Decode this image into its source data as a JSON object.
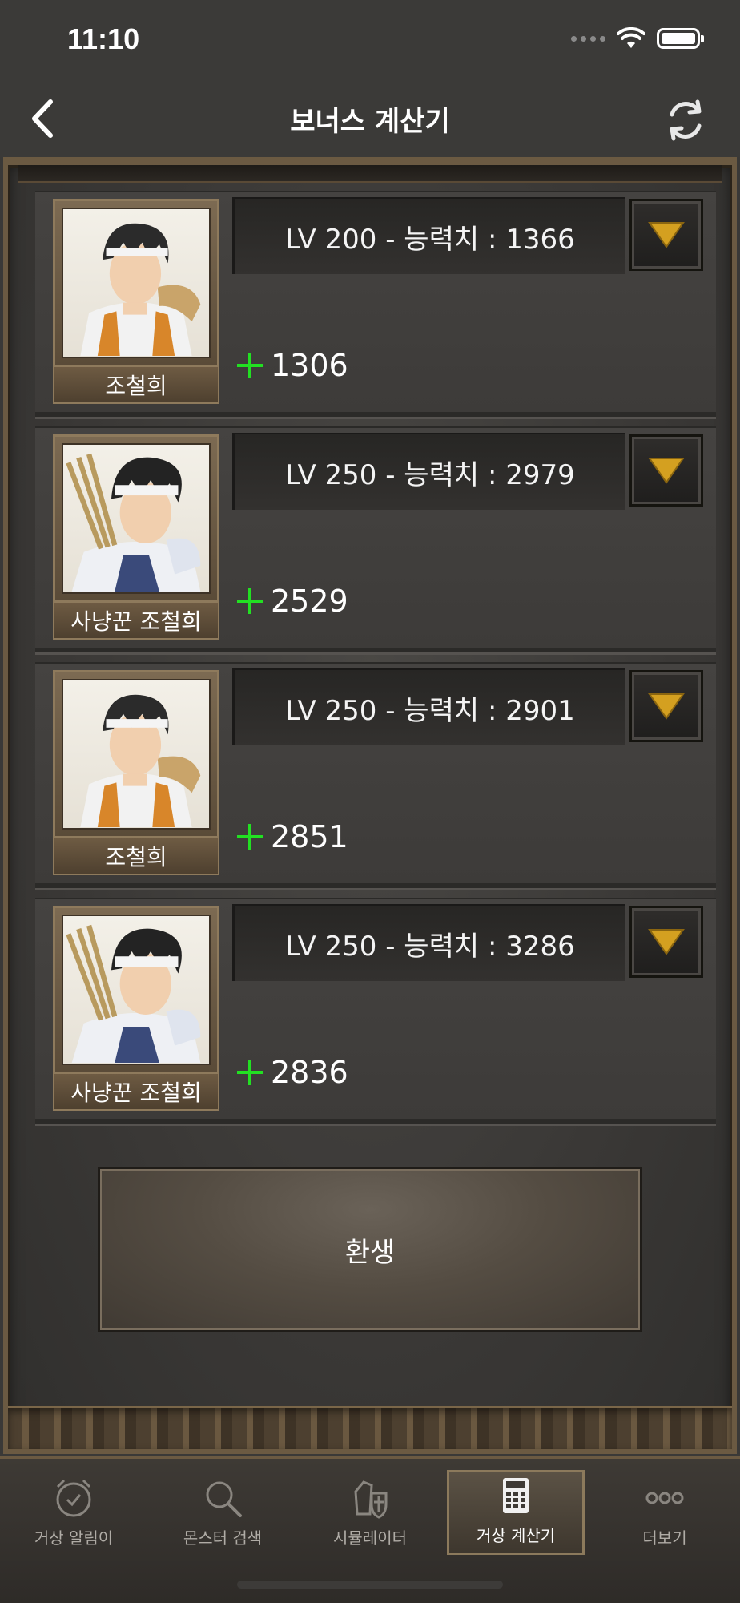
{
  "status_bar": {
    "time": "11:10"
  },
  "nav": {
    "title": "보너스 계산기",
    "back_icon": "chevron-left-icon",
    "refresh_icon": "refresh-icon"
  },
  "cards": [
    {
      "name": "조철희",
      "portrait": "bandana-warrior-portrait",
      "level_text": "LV 200 - 능력치 : 1366",
      "bonus": "1306"
    },
    {
      "name": "사냥꾼 조철희",
      "portrait": "hunter-with-arrows-portrait",
      "level_text": "LV 250 - 능력치 : 2979",
      "bonus": "2529"
    },
    {
      "name": "조철희",
      "portrait": "bandana-warrior-portrait",
      "level_text": "LV 250 - 능력치 : 2901",
      "bonus": "2851"
    },
    {
      "name": "사냥꾼 조철희",
      "portrait": "hunter-with-arrows-portrait",
      "level_text": "LV 250 - 능력치 : 3286",
      "bonus": "2836"
    }
  ],
  "rebirth_button": {
    "label": "환생"
  },
  "tabs": [
    {
      "label": "거상 알림이",
      "icon": "alarm-clock-icon",
      "active": false
    },
    {
      "label": "몬스터 검색",
      "icon": "search-icon",
      "active": false
    },
    {
      "label": "시뮬레이터",
      "icon": "armor-shield-icon",
      "active": false
    },
    {
      "label": "거상 계산기",
      "icon": "calculator-icon",
      "active": true
    },
    {
      "label": "더보기",
      "icon": "more-dots-icon",
      "active": false
    }
  ],
  "colors": {
    "bonus_plus": "#22e022",
    "frame_gold": "#6b5a42",
    "dropdown_arrow": "#d4a020"
  }
}
